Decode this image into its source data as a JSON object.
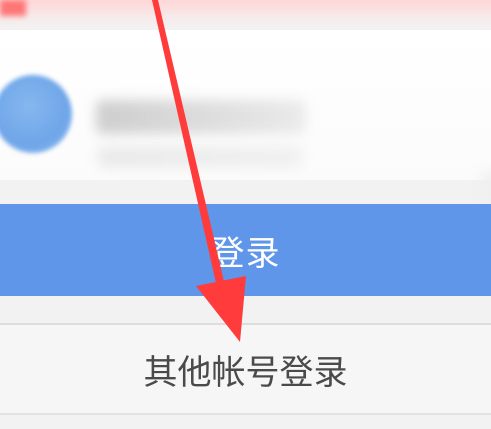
{
  "header": {
    "accent_color": "#ff6b6b"
  },
  "account_card": {
    "avatar_color": "#6fa6e9",
    "name_blurred": "",
    "sub_blurred": ""
  },
  "buttons": {
    "login_label": "登录",
    "other_login_label": "其他帐号登录",
    "login_color": "#5f96ea"
  },
  "annotation": {
    "icon": "red-arrow-icon",
    "color": "#ff3b3b"
  }
}
